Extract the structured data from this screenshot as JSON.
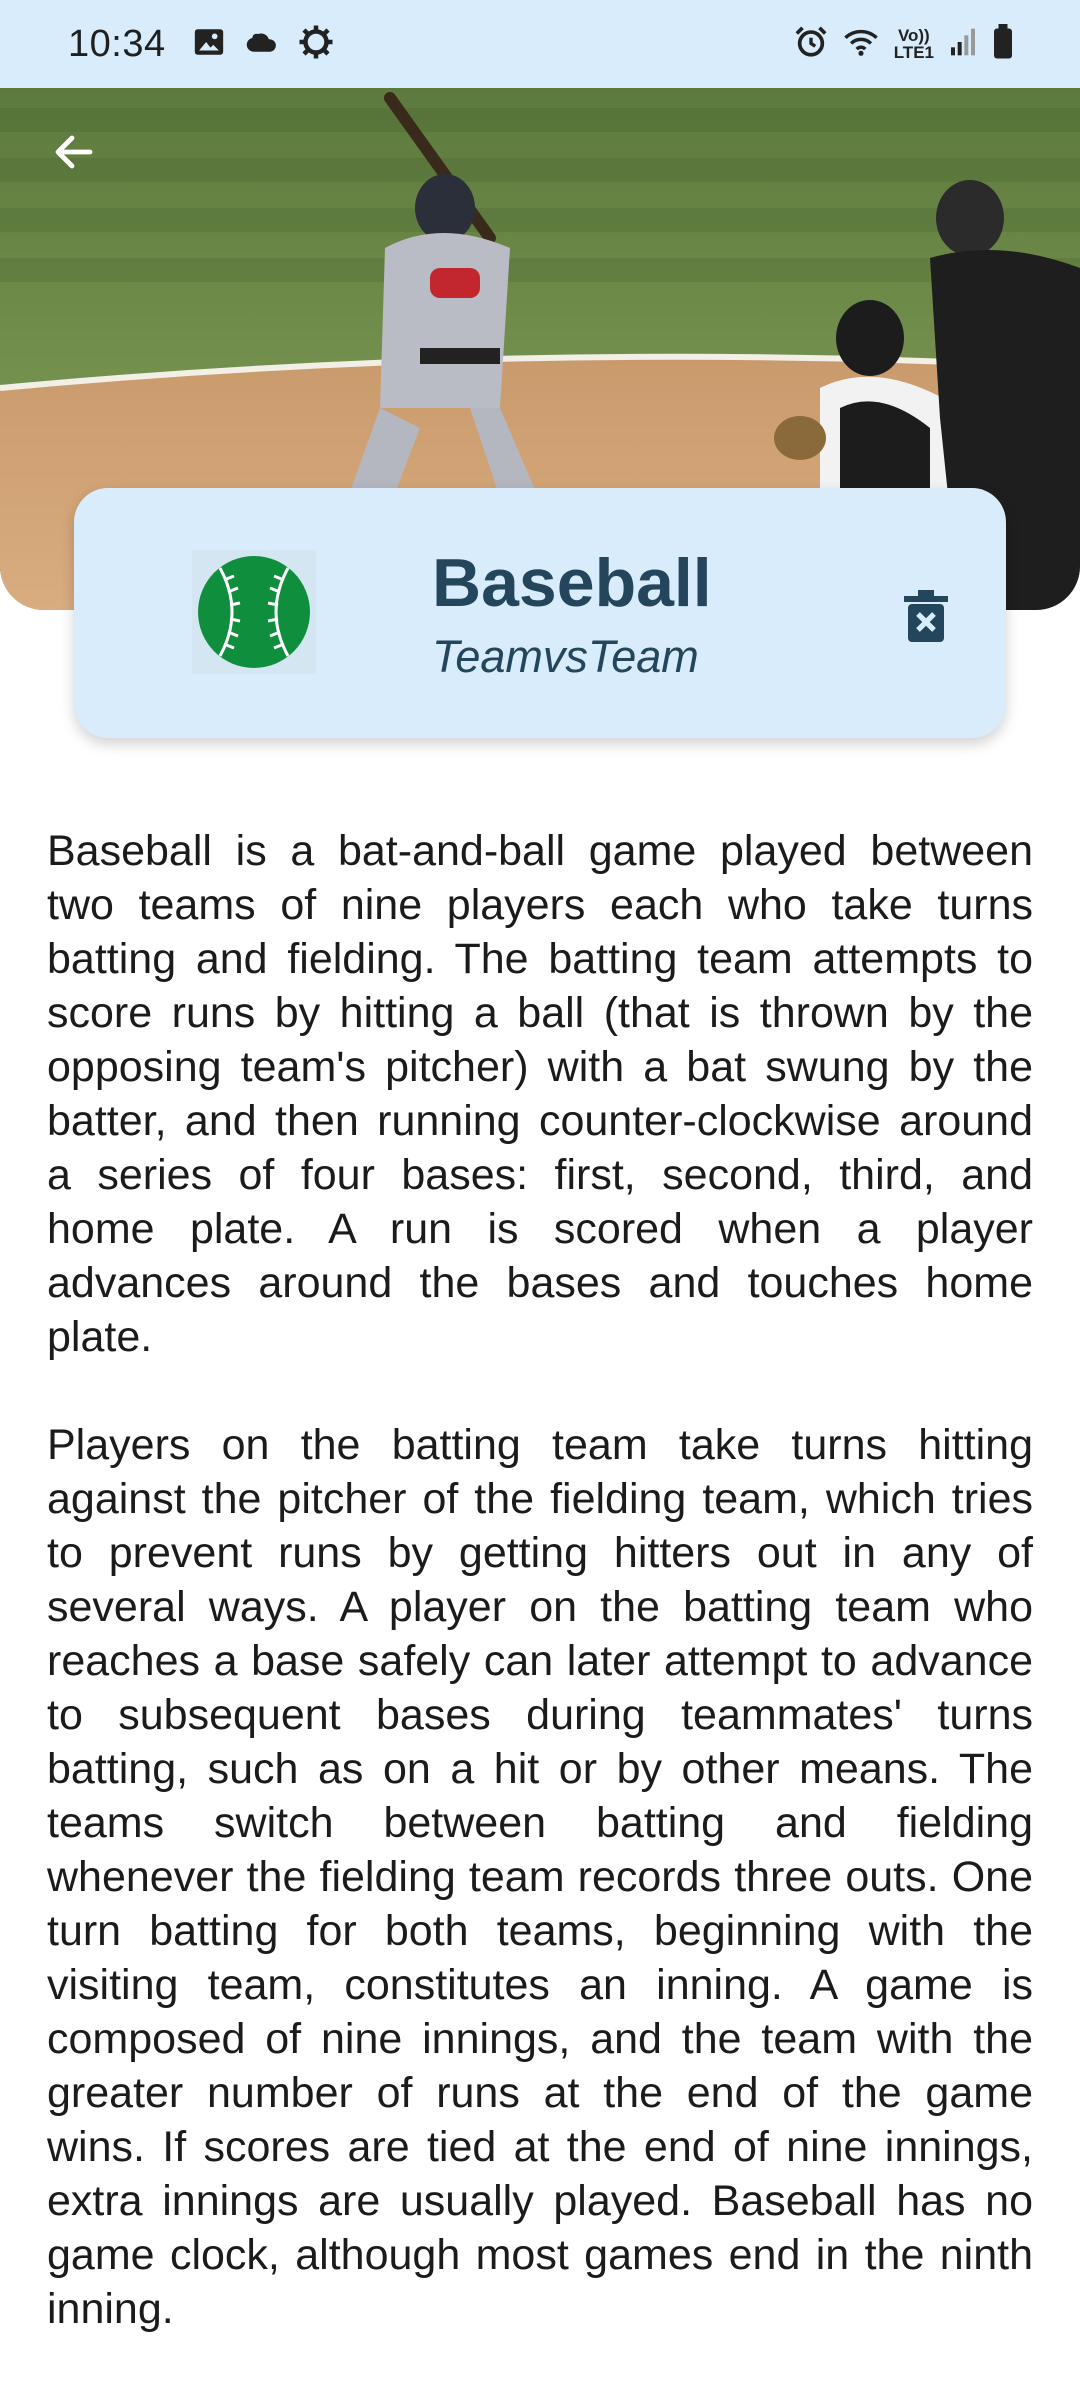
{
  "status_bar": {
    "time": "10:34",
    "left_icons": [
      "image-icon",
      "cloud-icon",
      "settings-icon"
    ],
    "right_icons": [
      "alarm-icon",
      "wifi-icon",
      "volte-icon",
      "signal-icon",
      "battery-icon"
    ],
    "volte_top": "Vo))",
    "volte_bottom": "LTE1"
  },
  "header": {
    "back_icon": "arrow-left-icon",
    "hero_image": "baseball-batter-photo"
  },
  "card": {
    "title": "Baseball",
    "subtitle": "TeamvsTeam",
    "logo_icon": "baseball-icon",
    "delete_icon": "delete-icon"
  },
  "description": {
    "paragraphs": [
      "Baseball is a bat-and-ball game played between two teams of nine players each who take turns batting and fielding. The batting team attempts to score runs by hitting a ball (that is thrown by the opposing team's pitcher) with a bat swung by the batter, and then running counter-clockwise around a series of four bases: first, second, third, and home plate. A run is scored when a player advances around the bases and touches home plate.",
      "Players on the batting team take turns hitting against the pitcher of the fielding team, which tries to prevent runs by getting hitters out in any of several ways. A player on the batting team who reaches a base safely can later attempt to advance to subsequent bases during teammates' turns batting, such as on a hit or by other means. The teams switch between batting and fielding whenever the fielding team records three outs. One turn batting for both teams, beginning with the visiting team, constitutes an inning. A game is composed of nine innings, and the team with the greater number of runs at the end of the game wins. If scores are tied at the end of nine innings, extra innings are usually played. Baseball has no game clock, although most games end in the ninth inning."
    ]
  },
  "colors": {
    "status_bar_bg": "#d8ecfb",
    "card_bg": "#d8ecfb",
    "title_text": "#23465c",
    "logo_green": "#0f8f3e"
  }
}
